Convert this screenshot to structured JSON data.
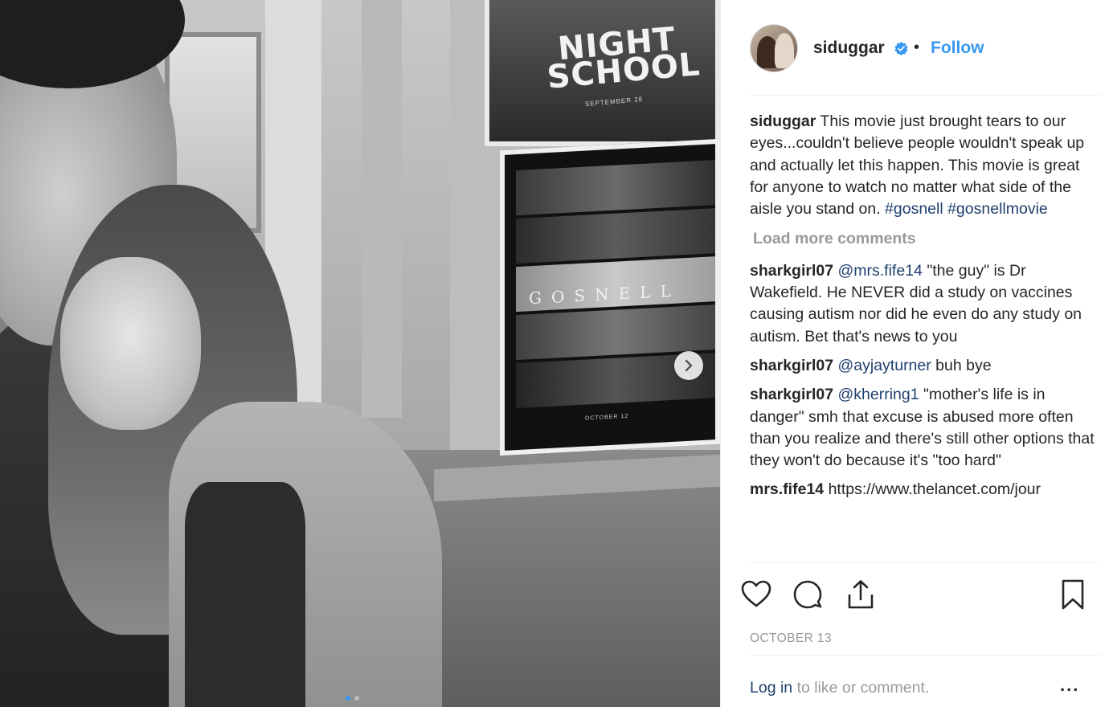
{
  "post": {
    "photo": {
      "poster_top_title": "NIGHT\nSCHOOL",
      "poster_top_date": "SEPTEMBER 28",
      "poster_bottom_word": "GOSNELL",
      "poster_bottom_release": "OCTOBER 12",
      "next_icon": "chevron-right-icon",
      "carousel_dots": 2
    },
    "header": {
      "username": "siduggar",
      "separator": "•",
      "follow_label": "Follow",
      "verified_icon": "verified-badge-icon"
    },
    "caption": {
      "user": "siduggar",
      "text": "This movie just brought tears to our eyes...couldn't believe people wouldn't speak up and actually let this happen. This movie is great for anyone to watch no matter what side of the aisle you stand on.",
      "tags": "#gosnell #gosnellmovie"
    },
    "load_more_label": "Load more comments",
    "comments": [
      {
        "user": "sharkgirl07",
        "mention": "@mrs.fife14",
        "text": "\"the guy\" is Dr Wakefield. He NEVER did a study on vaccines causing autism nor did he even do any study on autism. Bet that's news to you"
      },
      {
        "user": "sharkgirl07",
        "mention": "@ayjayturner",
        "text": "buh bye"
      },
      {
        "user": "sharkgirl07",
        "mention": "@kherring1",
        "text": "\"mother's life is in danger\" smh that excuse is abused more often than you realize and there's still other options that they won't do because it's \"too hard\""
      },
      {
        "user": "mrs.fife14",
        "mention": "",
        "text": "https://www.thelancet.com/jour"
      }
    ],
    "actions": {
      "like_icon": "heart-icon",
      "comment_icon": "comment-bubble-icon",
      "share_icon": "share-icon",
      "save_icon": "bookmark-icon"
    },
    "date": "OCTOBER 13",
    "footer": {
      "login_label": "Log in",
      "login_rest": "to like or comment.",
      "more_label": "..."
    },
    "colors": {
      "link_blue": "#3897f0",
      "mention_blue": "#1f3f6e",
      "muted_gray": "#999999",
      "text": "#262626"
    }
  }
}
